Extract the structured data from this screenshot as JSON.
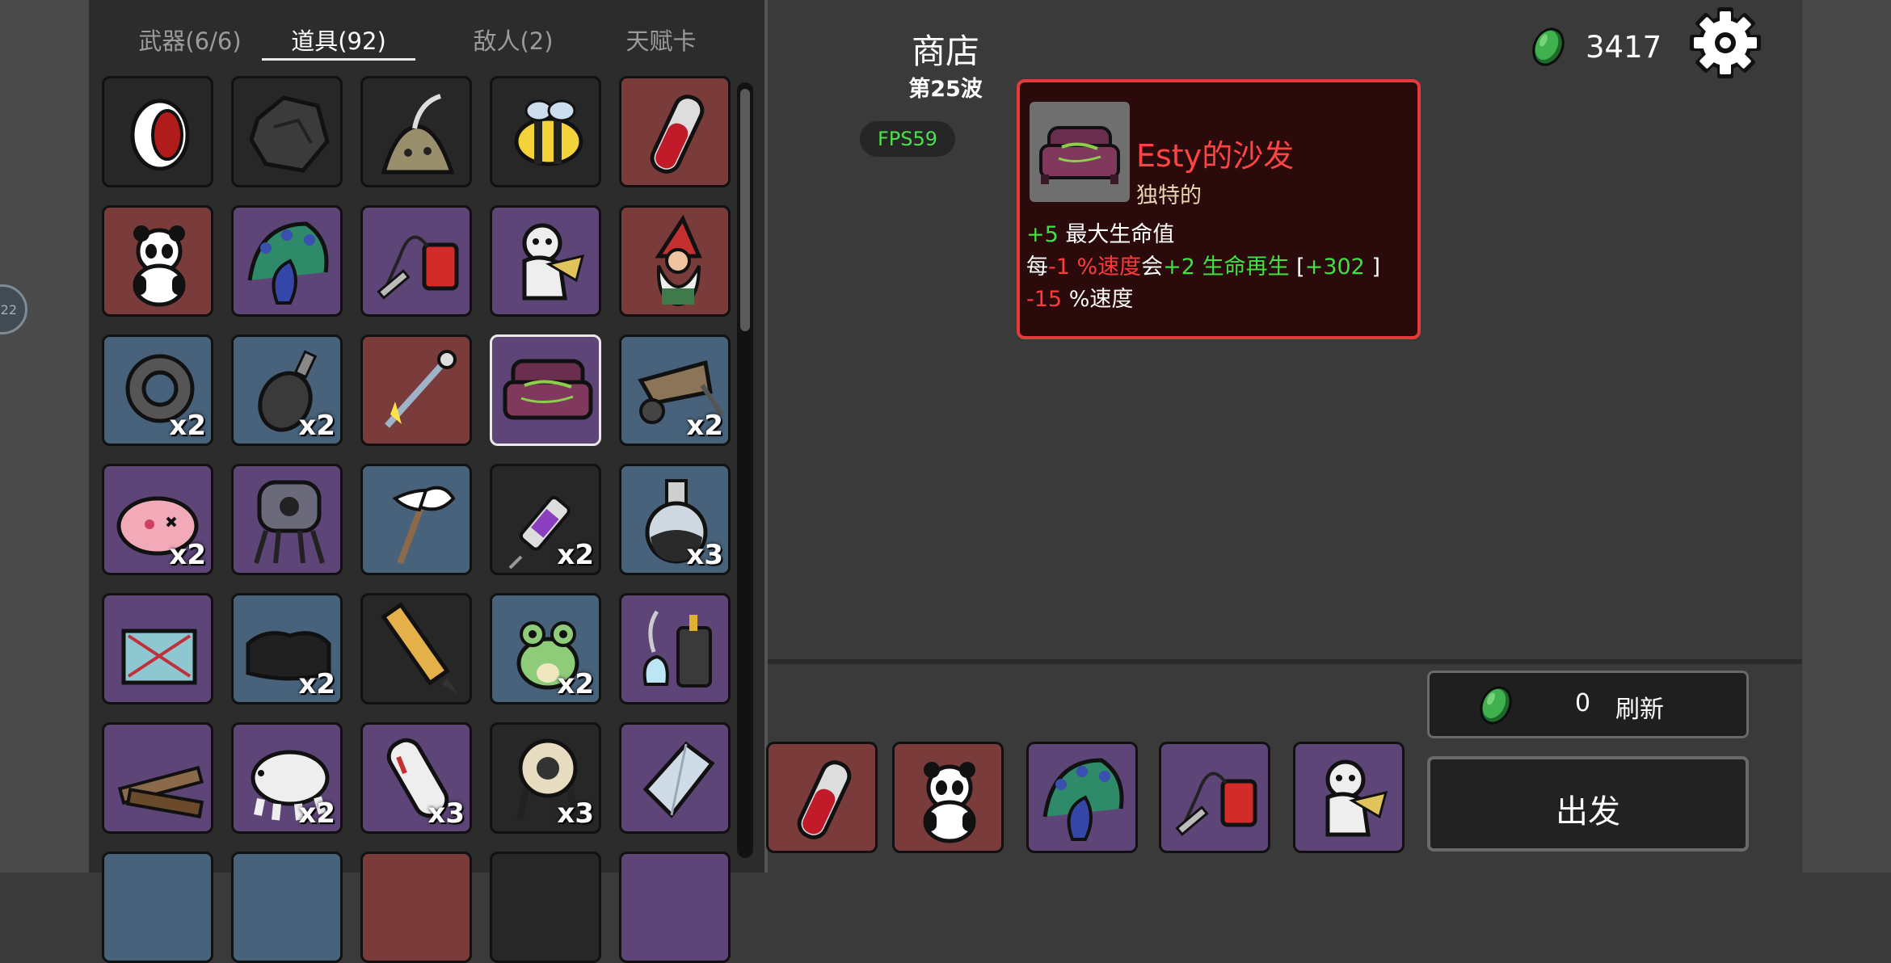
{
  "side_bubble": {
    "label": "22"
  },
  "tabs": [
    {
      "label": "武器(6/6)"
    },
    {
      "label": "道具(92)"
    },
    {
      "label": "敌人(2)"
    },
    {
      "label": "天赋卡"
    }
  ],
  "inventory": {
    "rows": [
      [
        {
          "icon": "vampire-mouth-icon",
          "bg": "dark",
          "count": ""
        },
        {
          "icon": "coal-rock-icon",
          "bg": "dark",
          "count": ""
        },
        {
          "icon": "alien-slug-icon",
          "bg": "dark",
          "count": ""
        },
        {
          "icon": "bee-icon",
          "bg": "dark",
          "count": ""
        },
        {
          "icon": "blood-vial-icon",
          "bg": "red",
          "count": ""
        }
      ],
      [
        {
          "icon": "panda-icon",
          "bg": "red",
          "count": ""
        },
        {
          "icon": "peacock-icon",
          "bg": "purple",
          "count": ""
        },
        {
          "icon": "blood-bag-icon",
          "bg": "purple",
          "count": ""
        },
        {
          "icon": "voodoo-doll-icon",
          "bg": "purple",
          "count": ""
        },
        {
          "icon": "gnome-icon",
          "bg": "red",
          "count": ""
        }
      ],
      [
        {
          "icon": "gear-wheel-icon",
          "bg": "blue",
          "count": "x2"
        },
        {
          "icon": "grenade-icon",
          "bg": "blue",
          "count": "x2"
        },
        {
          "icon": "taser-rod-icon",
          "bg": "red",
          "count": ""
        },
        {
          "icon": "sofa-icon",
          "bg": "purple",
          "count": "",
          "selected": true
        },
        {
          "icon": "wheelbarrow-icon",
          "bg": "blue",
          "count": "x2"
        }
      ],
      [
        {
          "icon": "pink-blob-icon",
          "bg": "purple",
          "count": "x2"
        },
        {
          "icon": "turret-icon",
          "bg": "purple",
          "count": ""
        },
        {
          "icon": "white-flag-icon",
          "bg": "blue",
          "count": ""
        },
        {
          "icon": "syringe-icon",
          "bg": "dark",
          "count": "x2"
        },
        {
          "icon": "potion-flask-icon",
          "bg": "blue",
          "count": "x3"
        }
      ],
      [
        {
          "icon": "tangled-box-icon",
          "bg": "purple",
          "count": ""
        },
        {
          "icon": "black-cloth-icon",
          "bg": "blue",
          "count": "x2"
        },
        {
          "icon": "pencil-icon",
          "bg": "dark",
          "count": ""
        },
        {
          "icon": "frog-icon",
          "bg": "blue",
          "count": "x2"
        },
        {
          "icon": "chemistry-set-icon",
          "bg": "purple",
          "count": ""
        }
      ],
      [
        {
          "icon": "wood-planks-icon",
          "bg": "purple",
          "count": ""
        },
        {
          "icon": "tardigrade-icon",
          "bg": "purple",
          "count": "x2"
        },
        {
          "icon": "rocket-shell-icon",
          "bg": "purple",
          "count": "x3"
        },
        {
          "icon": "target-turret-icon",
          "bg": "dark",
          "count": "x3"
        },
        {
          "icon": "crystal-block-icon",
          "bg": "purple",
          "count": ""
        }
      ]
    ]
  },
  "shop": {
    "title": "商店",
    "wave": "第25波"
  },
  "fps": "FPS59",
  "money": {
    "value": "3417",
    "icon": "green-coin-icon"
  },
  "settings_icon": "gear-icon",
  "tooltip": {
    "name": "Esty的沙发",
    "rarity": "独特的",
    "border_color": "#e63a3a",
    "line1": {
      "value": "+5",
      "text": " 最大生命值"
    },
    "line2": {
      "prefix": "每",
      "v1": "-1",
      "t1": " %速度",
      "mid": "会",
      "v2": "+2",
      "t2": " 生命再生",
      "bracket_open": " [",
      "bonus": "+302",
      "bracket_close": " ]"
    },
    "line3": {
      "value": "-15",
      "text": " %速度"
    }
  },
  "shop_items": [
    {
      "icon": "blood-vial-icon",
      "bg": "red"
    },
    {
      "icon": "panda-icon",
      "bg": "red"
    },
    {
      "icon": "peacock-icon",
      "bg": "purple"
    },
    {
      "icon": "blood-bag-icon",
      "bg": "purple"
    },
    {
      "icon": "voodoo-doll-icon",
      "bg": "purple"
    }
  ],
  "refresh": {
    "cost": "0",
    "label": "刷新"
  },
  "go": {
    "label": "出发"
  }
}
